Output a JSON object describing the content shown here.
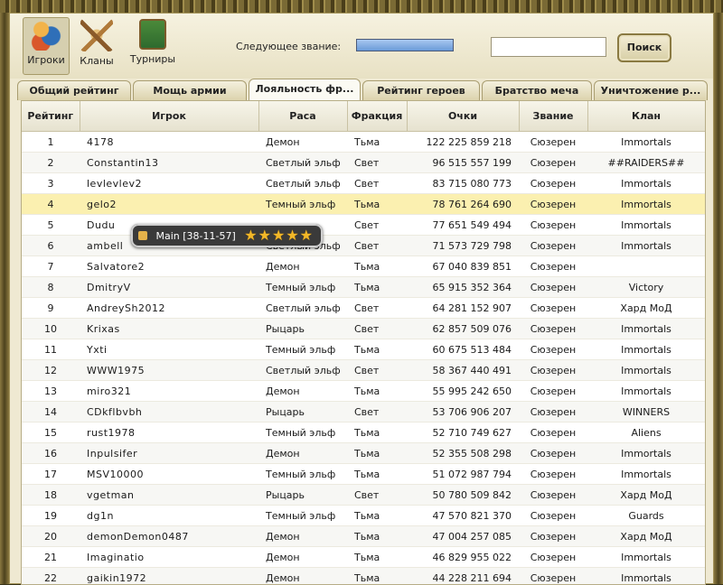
{
  "toolbar": {
    "players_label": "Игроки",
    "clans_label": "Кланы",
    "tournaments_label": "Турниры",
    "rank_label": "Следующее звание:",
    "rank_progress": 1.0,
    "search_placeholder": "",
    "search_button": "Поиск"
  },
  "tabs": [
    {
      "label": "Общий рейтинг"
    },
    {
      "label": "Мощь армии"
    },
    {
      "label": "Лояльность фр..."
    },
    {
      "label": "Рейтинг героев"
    },
    {
      "label": "Братство меча"
    },
    {
      "label": "Уничтожение р..."
    }
  ],
  "table": {
    "headers": [
      "Рейтинг",
      "Игрок",
      "Раса",
      "Фракция",
      "Очки",
      "Звание",
      "Клан"
    ],
    "rows": [
      {
        "rank": "1",
        "player": "4178",
        "race": "Демон",
        "fraction": "Тьма",
        "points": "122 225 859 218",
        "title": "Сюзерен",
        "clan": "Immortals"
      },
      {
        "rank": "2",
        "player": "Constantin13",
        "race": "Светлый эльф",
        "fraction": "Свет",
        "points": "96 515 557 199",
        "title": "Сюзерен",
        "clan": "##RAIDERS##"
      },
      {
        "rank": "3",
        "player": "levlevlev2",
        "race": "Светлый эльф",
        "fraction": "Свет",
        "points": "83 715 080 773",
        "title": "Сюзерен",
        "clan": "Immortals"
      },
      {
        "rank": "4",
        "player": "gelo2",
        "race": "Темный эльф",
        "fraction": "Тьма",
        "points": "78 761 264 690",
        "title": "Сюзерен",
        "clan": "Immortals"
      },
      {
        "rank": "5",
        "player": "Dudu",
        "race": "",
        "fraction": "Свет",
        "points": "77 651 549 494",
        "title": "Сюзерен",
        "clan": "Immortals"
      },
      {
        "rank": "6",
        "player": "ambell",
        "race": "Светлый эльф",
        "fraction": "Свет",
        "points": "71 573 729 798",
        "title": "Сюзерен",
        "clan": "Immortals"
      },
      {
        "rank": "7",
        "player": "Salvatore2",
        "race": "Демон",
        "fraction": "Тьма",
        "points": "67 040 839 851",
        "title": "Сюзерен",
        "clan": ""
      },
      {
        "rank": "8",
        "player": "DmitryV",
        "race": "Темный эльф",
        "fraction": "Тьма",
        "points": "65 915 352 364",
        "title": "Сюзерен",
        "clan": "Victory"
      },
      {
        "rank": "9",
        "player": "AndreySh2012",
        "race": "Светлый эльф",
        "fraction": "Свет",
        "points": "64 281 152 907",
        "title": "Сюзерен",
        "clan": "Хард МоД"
      },
      {
        "rank": "10",
        "player": "Krixas",
        "race": "Рыцарь",
        "fraction": "Свет",
        "points": "62 857 509 076",
        "title": "Сюзерен",
        "clan": "Immortals"
      },
      {
        "rank": "11",
        "player": "Yxti",
        "race": "Темный эльф",
        "fraction": "Тьма",
        "points": "60 675 513 484",
        "title": "Сюзерен",
        "clan": "Immortals"
      },
      {
        "rank": "12",
        "player": "WWW1975",
        "race": "Светлый эльф",
        "fraction": "Свет",
        "points": "58 367 440 491",
        "title": "Сюзерен",
        "clan": "Immortals"
      },
      {
        "rank": "13",
        "player": "miro321",
        "race": "Демон",
        "fraction": "Тьма",
        "points": "55 995 242 650",
        "title": "Сюзерен",
        "clan": "Immortals"
      },
      {
        "rank": "14",
        "player": "CDkflbvbh",
        "race": "Рыцарь",
        "fraction": "Свет",
        "points": "53 706 906 207",
        "title": "Сюзерен",
        "clan": "WINNERS"
      },
      {
        "rank": "15",
        "player": "rust1978",
        "race": "Темный эльф",
        "fraction": "Тьма",
        "points": "52 710 749 627",
        "title": "Сюзерен",
        "clan": "Aliens"
      },
      {
        "rank": "16",
        "player": "Inpulsifer",
        "race": "Демон",
        "fraction": "Тьма",
        "points": "52 355 508 298",
        "title": "Сюзерен",
        "clan": "Immortals"
      },
      {
        "rank": "17",
        "player": "MSV10000",
        "race": "Темный эльф",
        "fraction": "Тьма",
        "points": "51 072 987 794",
        "title": "Сюзерен",
        "clan": "Immortals"
      },
      {
        "rank": "18",
        "player": "vgetman",
        "race": "Рыцарь",
        "fraction": "Свет",
        "points": "50 780 509 842",
        "title": "Сюзерен",
        "clan": "Хард МоД"
      },
      {
        "rank": "19",
        "player": "dg1n",
        "race": "Темный эльф",
        "fraction": "Тьма",
        "points": "47 570 821 370",
        "title": "Сюзерен",
        "clan": "Guards"
      },
      {
        "rank": "20",
        "player": "demonDemon0487",
        "race": "Демон",
        "fraction": "Тьма",
        "points": "47 004 257 085",
        "title": "Сюзерен",
        "clan": "Хард МоД"
      },
      {
        "rank": "21",
        "player": "Imaginatio",
        "race": "Демон",
        "fraction": "Тьма",
        "points": "46 829 955 022",
        "title": "Сюзерен",
        "clan": "Immortals"
      },
      {
        "rank": "22",
        "player": "gaikin1972",
        "race": "Демон",
        "fraction": "Тьма",
        "points": "44 228 211 694",
        "title": "Сюзерен",
        "clan": "Immortals"
      }
    ],
    "highlight_row": 3
  },
  "tooltip": {
    "text": "Main [38-11-57]",
    "stars": "★★★★★",
    "star_count": 5
  }
}
